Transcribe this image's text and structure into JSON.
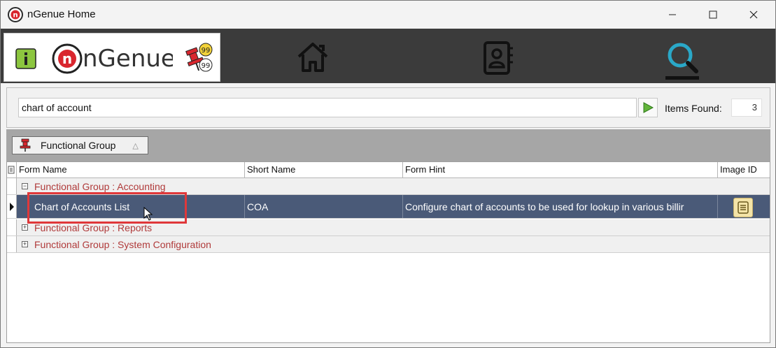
{
  "window": {
    "title": "nGenue Home"
  },
  "toolbar": {
    "brand_text": "nGenue",
    "badge_top": "99",
    "badge_bottom": "99",
    "nav": [
      "home-icon",
      "contacts-icon",
      "search-icon"
    ]
  },
  "search": {
    "query": "chart of account",
    "items_found_label": "Items Found:",
    "items_found_count": "3"
  },
  "group_by": {
    "label": "Functional Group",
    "sort_glyph": "△"
  },
  "grid": {
    "columns": [
      "Form Name",
      "Short Name",
      "Form Hint",
      "Image ID"
    ],
    "groups": [
      {
        "label": "Functional Group : Accounting",
        "expander": "−",
        "rows": [
          {
            "form_name": "Chart of Accounts List",
            "short_name": "COA",
            "form_hint": "Configure chart of accounts to be used for lookup in various billir",
            "image_icon": "form-icon"
          }
        ]
      },
      {
        "label": "Functional Group : Reports",
        "expander": "+"
      },
      {
        "label": "Functional Group : System Configuration",
        "expander": "+"
      }
    ]
  },
  "colors": {
    "toolbar_bg": "#3b3b3b",
    "selected_row": "#4a5a78",
    "group_text": "#b03a3a",
    "highlight": "#e0383a",
    "accent_cyan": "#2aa8c8"
  }
}
